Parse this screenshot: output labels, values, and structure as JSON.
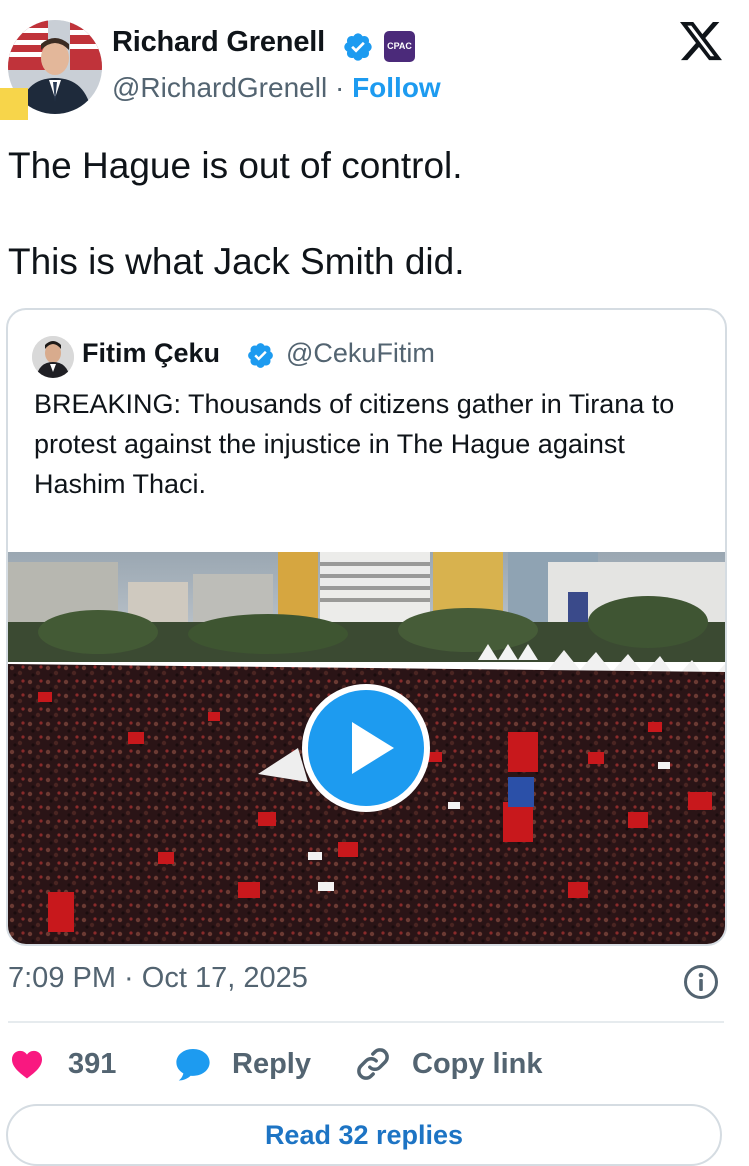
{
  "author": {
    "name": "Richard Grenell",
    "handle": "@RichardGrenell",
    "separator": "·",
    "follow_label": "Follow",
    "affiliation_badge": "CPAC"
  },
  "tweet": {
    "text": "The Hague is out of control.\n\nThis is what Jack Smith did."
  },
  "quoted_tweet": {
    "name": "Fitim Çeku",
    "handle": "@CekuFitim",
    "text": "BREAKING: Thousands of citizens gather in Tirana to protest against the injustice in The Hague against Hashim Thaci.",
    "media": {
      "type": "video",
      "play_icon": "play-icon"
    }
  },
  "meta": {
    "timestamp": "7:09 PM · Oct 17, 2025"
  },
  "actions": {
    "likes_count": "391",
    "reply_label": "Reply",
    "copy_link_label": "Copy link"
  },
  "read_replies_label": "Read 32 replies",
  "icons": [
    "x-logo-icon",
    "verified-badge-icon",
    "heart-icon",
    "reply-bubble-icon",
    "link-icon",
    "info-icon",
    "play-icon"
  ],
  "colors": {
    "accent": "#1d9bf0",
    "like": "#f91880",
    "text_primary": "#0f1419",
    "text_secondary": "#536471",
    "border": "#d5dce2",
    "read_replies_text": "#1d74c4"
  }
}
